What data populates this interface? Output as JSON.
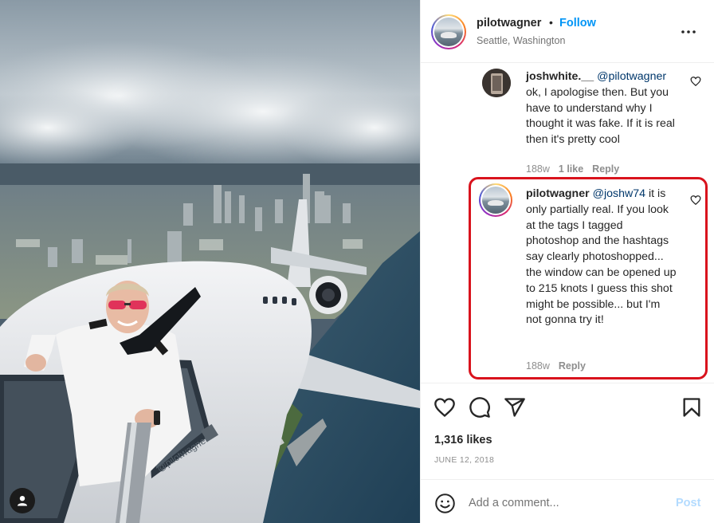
{
  "post": {
    "username": "pilotwagner",
    "separator": "•",
    "follow_label": "Follow",
    "location": "Seattle, Washington",
    "more_icon": "more-horizontal-icon",
    "image_watermark": "@pilotwagner"
  },
  "comments": [
    {
      "username": "joshwhite.__",
      "mention": "@pilotwagner",
      "text": "ok, I apologise then. But you have to understand why I thought it was fake. If it is real then it's pretty cool",
      "age": "188w",
      "likes": "1 like",
      "reply_label": "Reply"
    },
    {
      "username": "pilotwagner",
      "mention": "@joshw74",
      "text": "it is only partially real. If you look at the tags I tagged photoshop and the hashtags say clearly photoshopped... the window can be opened up to 215 knots I guess this shot might be possible... but I'm not gonna try it!",
      "age": "188w",
      "reply_label": "Reply"
    }
  ],
  "actions": {
    "like_icon": "heart-icon",
    "comment_icon": "comment-icon",
    "share_icon": "send-icon",
    "save_icon": "bookmark-icon"
  },
  "likes_count": "1,316 likes",
  "date": "JUNE 12, 2018",
  "add_comment": {
    "placeholder": "Add a comment...",
    "post_label": "Post",
    "emoji_icon": "emoji-icon"
  },
  "colors": {
    "follow_blue": "#0095f6",
    "mention_blue": "#00376b",
    "highlight_red": "#d9131d",
    "post_disabled": "#b3dbff"
  }
}
